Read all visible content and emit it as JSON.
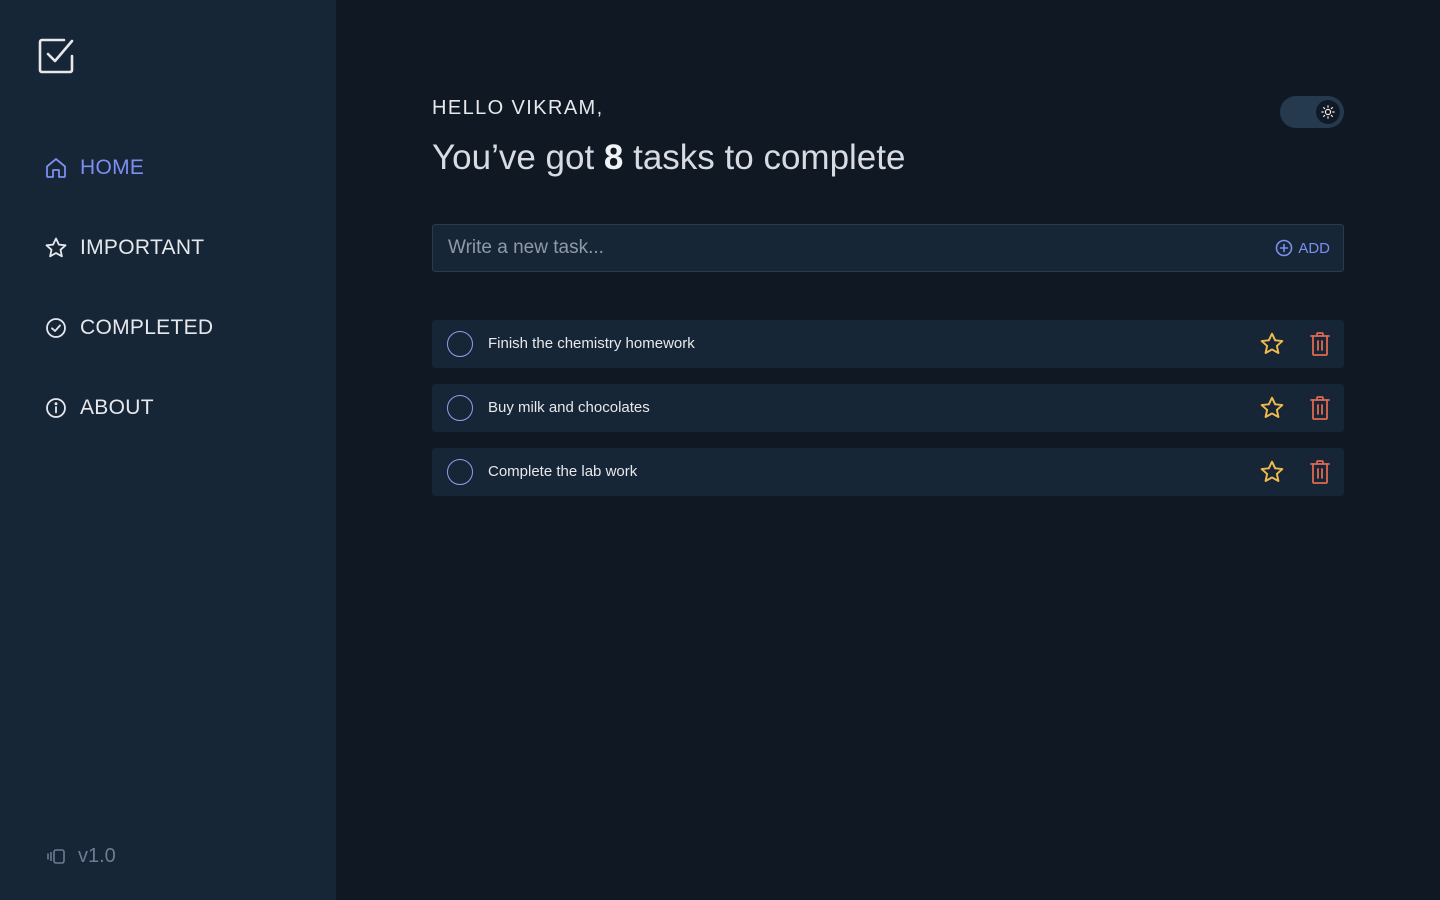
{
  "sidebar": {
    "logo": "checkbox-logo-icon",
    "items": [
      {
        "label": "HOME",
        "icon": "home-icon",
        "active": true
      },
      {
        "label": "IMPORTANT",
        "icon": "star-icon",
        "active": false
      },
      {
        "label": "COMPLETED",
        "icon": "check-circle-icon",
        "active": false
      },
      {
        "label": "ABOUT",
        "icon": "info-icon",
        "active": false
      }
    ],
    "version": "v1.0"
  },
  "header": {
    "greeting": "HELLO VIKRAM,",
    "headline_prefix": "You’ve got ",
    "task_count": "8",
    "headline_suffix": " tasks to complete",
    "theme_toggle_icon": "sun-icon"
  },
  "new_task": {
    "placeholder": "Write a new task...",
    "value": "",
    "add_label": "ADD"
  },
  "tasks": [
    {
      "title": "Finish the chemistry homework",
      "completed": false,
      "important": false
    },
    {
      "title": "Buy milk and chocolates",
      "completed": false,
      "important": false
    },
    {
      "title": "Complete the lab work",
      "completed": false,
      "important": false
    }
  ],
  "colors": {
    "background": "#101923",
    "sidebar": "#172636",
    "accent": "#7b8ff0",
    "star": "#f0b94b",
    "trash": "#e0694f"
  }
}
